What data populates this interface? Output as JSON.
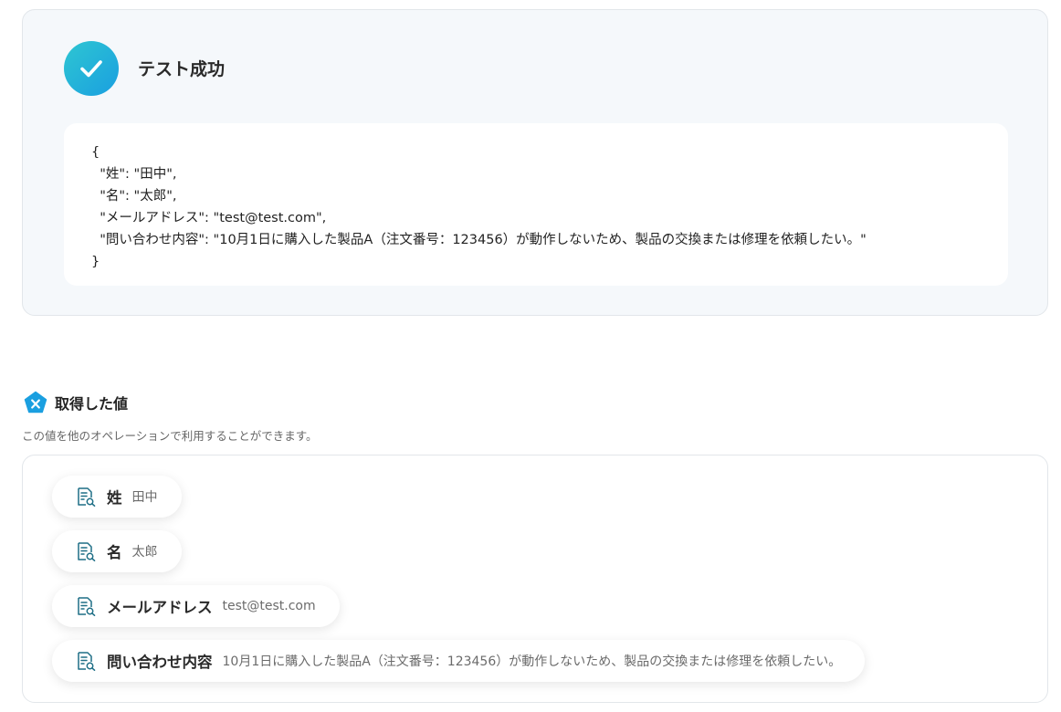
{
  "test_result": {
    "title": "テスト成功",
    "json_lines": [
      "{",
      "  \"姓\": \"田中\",",
      "  \"名\": \"太郎\",",
      "  \"メールアドレス\": \"test@test.com\",",
      "  \"問い合わせ内容\": \"10月1日に購入した製品A（注文番号：123456）が動作しないため、製品の交換または修理を依頼したい。\"",
      "}"
    ]
  },
  "values_section": {
    "title": "取得した値",
    "description": "この値を他のオペレーションで利用することができます。",
    "items": [
      {
        "key": "姓",
        "value": "田中"
      },
      {
        "key": "名",
        "value": "太郎"
      },
      {
        "key": "メールアドレス",
        "value": "test@test.com"
      },
      {
        "key": "問い合わせ内容",
        "value": "10月1日に購入した製品A（注文番号：123456）が動作しないため、製品の交換または修理を依頼したい。"
      }
    ]
  },
  "colors": {
    "accent": "#1a9fe0",
    "panel_bg": "#f5f8fb",
    "icon_teal": "#1f6f86"
  },
  "icons": {
    "success": "check-icon",
    "section": "variable-pentagon-icon",
    "chip": "document-search-icon"
  }
}
